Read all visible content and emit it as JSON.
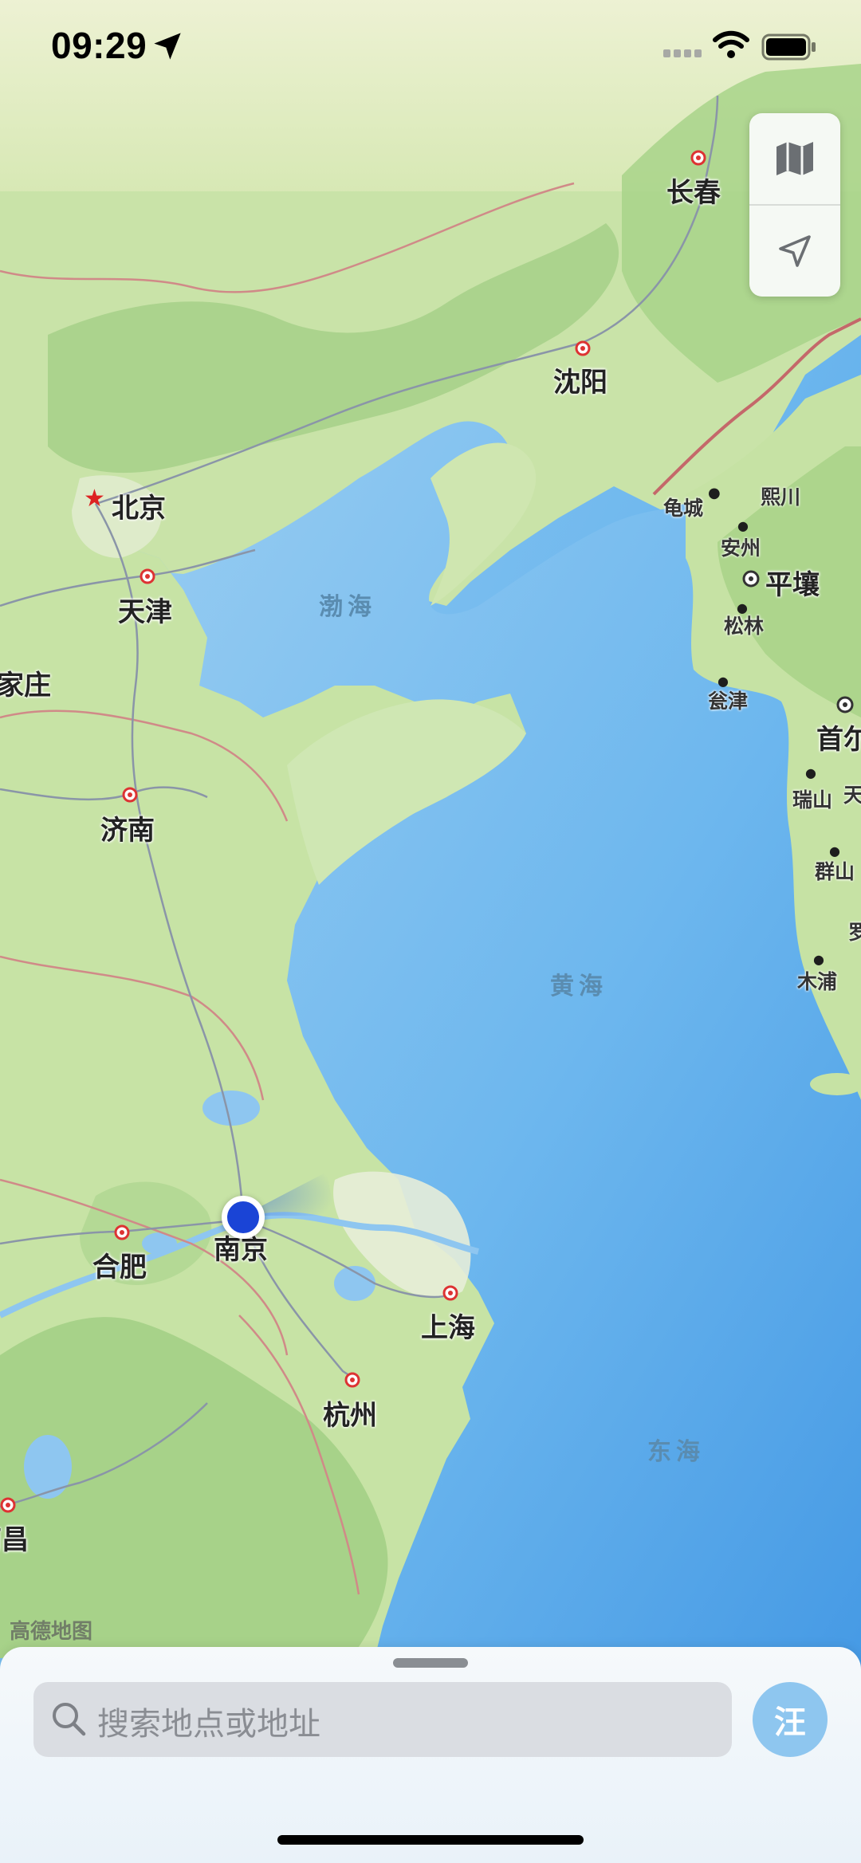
{
  "status_bar": {
    "time": "09:29",
    "icons": [
      "location-arrow-icon",
      "cellular-signal-icon",
      "wifi-icon",
      "battery-icon"
    ]
  },
  "map": {
    "provider_watermark": "高德地图",
    "colors": {
      "land": "#c8e3a6",
      "forest": "#9cc97c",
      "sea_near": "#8ec6f0",
      "sea_far": "#4b9fe6",
      "border": "#c4686a",
      "road": "#8a95a8"
    },
    "cities": [
      {
        "name": "长春",
        "kind": "city"
      },
      {
        "name": "沈阳",
        "kind": "city"
      },
      {
        "name": "北京",
        "kind": "capital"
      },
      {
        "name": "天津",
        "kind": "city"
      },
      {
        "name": "家庄",
        "kind": "city"
      },
      {
        "name": "济南",
        "kind": "city"
      },
      {
        "name": "合肥",
        "kind": "city"
      },
      {
        "name": "南京",
        "kind": "current-location"
      },
      {
        "name": "上海",
        "kind": "city"
      },
      {
        "name": "杭州",
        "kind": "city"
      },
      {
        "name": "南昌",
        "kind": "city"
      },
      {
        "name": "平壤",
        "kind": "capital"
      },
      {
        "name": "首尔",
        "kind": "capital"
      }
    ],
    "towns": [
      "龟城",
      "熙川",
      "安州",
      "松林",
      "瓮津",
      "瑞山",
      "天",
      "群山",
      "罗",
      "木浦"
    ],
    "seas": [
      "渤海",
      "黄海",
      "东海"
    ]
  },
  "controls": {
    "map_mode_icon": "map-icon",
    "locate_icon": "location-arrow-outline-icon"
  },
  "bottom_sheet": {
    "search_placeholder": "搜索地点或地址",
    "avatar_text": "汪",
    "search_icon": "search-icon"
  }
}
